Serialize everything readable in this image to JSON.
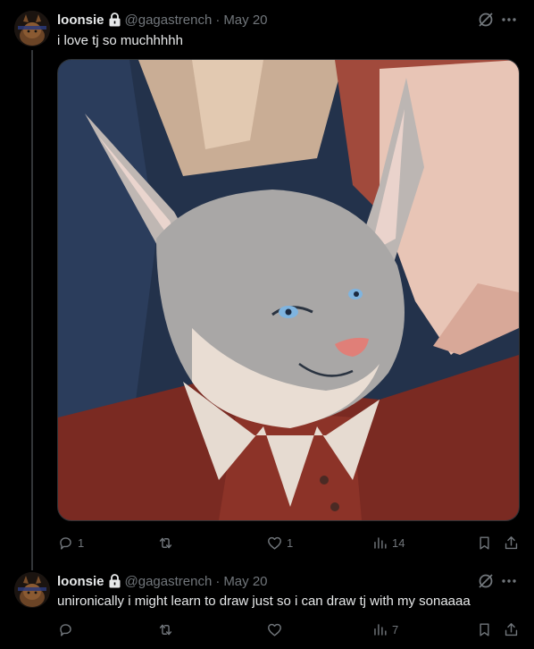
{
  "tweets": [
    {
      "display_name": "loonsie",
      "handle": "@gagastrench",
      "separator": "·",
      "date": "May 20",
      "text": "i love tj so muchhhhh",
      "actions": {
        "replies": "1",
        "retweets": "",
        "likes": "1",
        "views": "14"
      }
    },
    {
      "display_name": "loonsie",
      "handle": "@gagastrench",
      "separator": "·",
      "date": "May 20",
      "text": "unironically i might learn to draw just so i can draw tj with my sonaaaa",
      "actions": {
        "replies": "",
        "retweets": "",
        "likes": "",
        "views": "7"
      }
    }
  ],
  "icons": {
    "lock": "lock-icon",
    "grok": "grok-icon",
    "more": "more-icon",
    "reply": "reply-icon",
    "retweet": "retweet-icon",
    "like": "like-icon",
    "views": "views-icon",
    "bookmark": "bookmark-icon",
    "share": "share-icon"
  },
  "colors": {
    "background": "#000000",
    "text": "#e7e9ea",
    "muted": "#71767b",
    "divider": "#2f3336"
  }
}
